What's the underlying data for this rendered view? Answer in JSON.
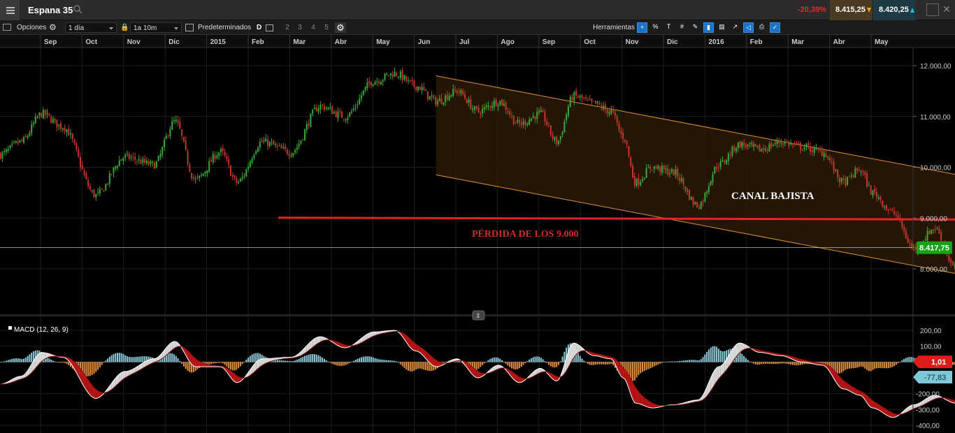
{
  "header": {
    "symbol": "Espana 35",
    "change": "-20,39%",
    "sell_price": "8.415,25",
    "buy_price": "8.420,25"
  },
  "toolbar": {
    "options_label": "Opciones",
    "timeframe": "1 día",
    "range": "1a 10m",
    "presets_label": "Predeterminados",
    "d_label": "D",
    "layout_numbers": [
      "2",
      "3",
      "4",
      "5"
    ],
    "tools_label": "Herramientas",
    "tool_icons": [
      "crosshair-icon",
      "percent-icon",
      "text-size-icon",
      "grid-icon",
      "draw-icon",
      "candle-icon",
      "bars-compare-icon",
      "line-chart-icon",
      "tag-icon",
      "print-icon",
      "settings-wrench-icon"
    ]
  },
  "colors": {
    "up": "#3aa83a",
    "down": "#c0392b",
    "channel": "#e8902a",
    "support_line": "#e02424",
    "price_badge": "#16a316",
    "macd_badge": "#e01b1b",
    "signal_badge": "#7ec8d8",
    "annotation_red": "#d22a2a"
  },
  "chart_data": {
    "type": "candlestick",
    "instrument": "Espana 35",
    "x_months": [
      "Sep",
      "Oct",
      "Nov",
      "Dic",
      "2015",
      "Feb",
      "Mar",
      "Abr",
      "May",
      "Jun",
      "Jul",
      "Ago",
      "Sep",
      "Oct",
      "Nov",
      "Dic",
      "2016",
      "Feb",
      "Mar",
      "Abr",
      "May"
    ],
    "price_axis_ticks": [
      "12.000,00",
      "11.000,00",
      "10.000,00",
      "9.000,00",
      "8.000,00"
    ],
    "ylim": [
      7350,
      12450
    ],
    "current_price": "8.417,75",
    "current_price_value": 8417.75,
    "close_path": [
      {
        "m": 0,
        "v": 10250
      },
      {
        "m": 0.5,
        "v": 10500
      },
      {
        "m": 1,
        "v": 11050
      },
      {
        "m": 1.5,
        "v": 10800
      },
      {
        "m": 2.3,
        "v": 9450
      },
      {
        "m": 3,
        "v": 10200
      },
      {
        "m": 3.7,
        "v": 10050
      },
      {
        "m": 4.2,
        "v": 10900
      },
      {
        "m": 4.7,
        "v": 9750
      },
      {
        "m": 5.3,
        "v": 10300
      },
      {
        "m": 5.7,
        "v": 9700
      },
      {
        "m": 6.3,
        "v": 10500
      },
      {
        "m": 7,
        "v": 10300
      },
      {
        "m": 7.7,
        "v": 11200
      },
      {
        "m": 8.3,
        "v": 11000
      },
      {
        "m": 9,
        "v": 11700
      },
      {
        "m": 9.5,
        "v": 11850
      },
      {
        "m": 10,
        "v": 11600
      },
      {
        "m": 10.5,
        "v": 11300
      },
      {
        "m": 11,
        "v": 11500
      },
      {
        "m": 11.5,
        "v": 11100
      },
      {
        "m": 12,
        "v": 11300
      },
      {
        "m": 12.5,
        "v": 10850
      },
      {
        "m": 13,
        "v": 11050
      },
      {
        "m": 13.4,
        "v": 10500
      },
      {
        "m": 13.8,
        "v": 11400
      },
      {
        "m": 14.3,
        "v": 11250
      },
      {
        "m": 14.7,
        "v": 11100
      },
      {
        "m": 15,
        "v": 10600
      },
      {
        "m": 15.3,
        "v": 9700
      },
      {
        "m": 15.7,
        "v": 10000
      },
      {
        "m": 16.2,
        "v": 9900
      },
      {
        "m": 16.8,
        "v": 9250
      },
      {
        "m": 17.3,
        "v": 10050
      },
      {
        "m": 17.8,
        "v": 10450
      },
      {
        "m": 18.3,
        "v": 10350
      },
      {
        "m": 18.8,
        "v": 10500
      },
      {
        "m": 19.3,
        "v": 10400
      },
      {
        "m": 19.8,
        "v": 10300
      },
      {
        "m": 20.3,
        "v": 9700
      },
      {
        "m": 20.7,
        "v": 9950
      },
      {
        "m": 21,
        "v": 9500
      },
      {
        "m": 21.5,
        "v": 9100
      },
      {
        "m": 22,
        "v": 8400
      },
      {
        "m": 22.5,
        "v": 8800
      },
      {
        "m": 23,
        "v": 8000
      },
      {
        "m": 23.3,
        "v": 7800
      },
      {
        "m": 23.8,
        "v": 8200
      },
      {
        "m": 24.3,
        "v": 8600
      },
      {
        "m": 24.8,
        "v": 8900
      },
      {
        "m": 25.2,
        "v": 9150
      },
      {
        "m": 25.7,
        "v": 8950
      },
      {
        "m": 26.1,
        "v": 8700
      },
      {
        "m": 26.4,
        "v": 8420
      }
    ],
    "channel": {
      "upper": [
        {
          "m": 10.5,
          "v": 11800
        },
        {
          "m": 26.8,
          "v": 9270
        }
      ],
      "lower": [
        {
          "m": 10.5,
          "v": 9850
        },
        {
          "m": 26.8,
          "v": 7320
        }
      ]
    },
    "support_level": 9000,
    "annotations": [
      "CANAL BAJISTA",
      "PÉRDIDA DE LOS 9.000"
    ],
    "macd": {
      "label": "MACD (12, 26, 9)",
      "axis_ticks": [
        "200,00",
        "100,00",
        "-200,00",
        "-300,00",
        "-400,00"
      ],
      "ylim": [
        -420,
        230
      ],
      "macd_value": "1,01",
      "signal_value": "-77,83",
      "macd_path": [
        {
          "m": 0,
          "v": -140
        },
        {
          "m": 0.5,
          "v": -90
        },
        {
          "m": 1,
          "v": 60
        },
        {
          "m": 1.5,
          "v": 30
        },
        {
          "m": 2.3,
          "v": -230
        },
        {
          "m": 3,
          "v": -60
        },
        {
          "m": 3.7,
          "v": 20
        },
        {
          "m": 4.2,
          "v": 130
        },
        {
          "m": 4.7,
          "v": -30
        },
        {
          "m": 5.3,
          "v": -30
        },
        {
          "m": 5.7,
          "v": -130
        },
        {
          "m": 6.3,
          "v": 20
        },
        {
          "m": 7,
          "v": 30
        },
        {
          "m": 7.7,
          "v": 160
        },
        {
          "m": 8.3,
          "v": 90
        },
        {
          "m": 9,
          "v": 190
        },
        {
          "m": 9.5,
          "v": 200
        },
        {
          "m": 10,
          "v": 70
        },
        {
          "m": 10.5,
          "v": -30
        },
        {
          "m": 11,
          "v": 20
        },
        {
          "m": 11.5,
          "v": -100
        },
        {
          "m": 12,
          "v": -20
        },
        {
          "m": 12.5,
          "v": -130
        },
        {
          "m": 13,
          "v": -40
        },
        {
          "m": 13.4,
          "v": -120
        },
        {
          "m": 13.8,
          "v": 120
        },
        {
          "m": 14.3,
          "v": 40
        },
        {
          "m": 14.7,
          "v": 20
        },
        {
          "m": 15,
          "v": -100
        },
        {
          "m": 15.3,
          "v": -260
        },
        {
          "m": 15.7,
          "v": -290
        },
        {
          "m": 16.2,
          "v": -270
        },
        {
          "m": 16.8,
          "v": -240
        },
        {
          "m": 17.3,
          "v": -30
        },
        {
          "m": 17.8,
          "v": 120
        },
        {
          "m": 18.3,
          "v": 60
        },
        {
          "m": 18.8,
          "v": 40
        },
        {
          "m": 19.3,
          "v": 0
        },
        {
          "m": 19.8,
          "v": -20
        },
        {
          "m": 20.3,
          "v": -170
        },
        {
          "m": 20.7,
          "v": -210
        },
        {
          "m": 21,
          "v": -290
        },
        {
          "m": 21.5,
          "v": -350
        },
        {
          "m": 22,
          "v": -270
        },
        {
          "m": 22.5,
          "v": -210
        },
        {
          "m": 23,
          "v": -260
        },
        {
          "m": 23.3,
          "v": -280
        },
        {
          "m": 23.8,
          "v": -130
        },
        {
          "m": 24.3,
          "v": 20
        },
        {
          "m": 24.8,
          "v": 140
        },
        {
          "m": 25.2,
          "v": 170
        },
        {
          "m": 25.7,
          "v": 140
        },
        {
          "m": 26.1,
          "v": 40
        },
        {
          "m": 26.4,
          "v": -40
        }
      ]
    }
  }
}
